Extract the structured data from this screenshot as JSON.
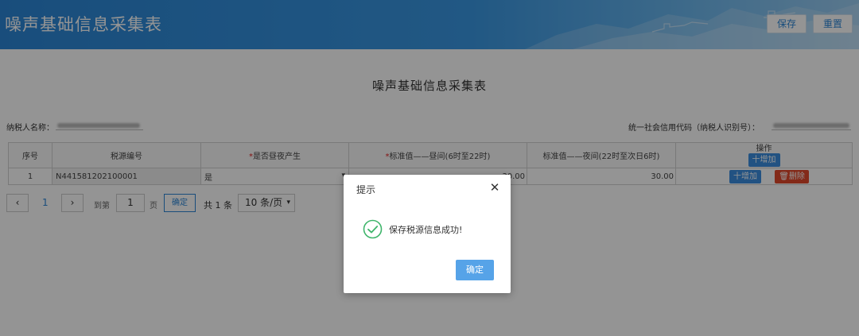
{
  "header": {
    "title": "噪声基础信息采集表",
    "save_label": "保存",
    "reset_label": "重置"
  },
  "form": {
    "title": "噪声基础信息采集表",
    "taxpayer_label": "纳税人名称：",
    "credit_code_label": "统一社会信用代码（纳税人识别号）："
  },
  "table": {
    "headers": {
      "seq": "序号",
      "source_no": "税源编号",
      "night_flag": "是否昼夜产生",
      "day_std": "标准值——昼间(6时至22时)",
      "night_std": "标准值——夜间(22时至次日6时)",
      "ops": "操作",
      "add_label": "十增加"
    },
    "rows": [
      {
        "seq": "1",
        "source_no": "N441581202100001",
        "night_flag": "是",
        "day_std": "30.00",
        "night_std": "30.00",
        "add_label": "十增加",
        "delete_label": "删除"
      }
    ]
  },
  "pager": {
    "current_page": "1",
    "goto_label": "到第",
    "page_input": "1",
    "page_unit": "页",
    "confirm_label": "确定",
    "total_label": "共 1 条",
    "page_size": "10 条/页"
  },
  "dialog": {
    "title": "提示",
    "message": "保存税源信息成功!",
    "ok_label": "确定"
  },
  "colors": {
    "header_blue": "#2b86d6",
    "success_green": "#3fb56b",
    "delete_red": "#e2492b"
  }
}
